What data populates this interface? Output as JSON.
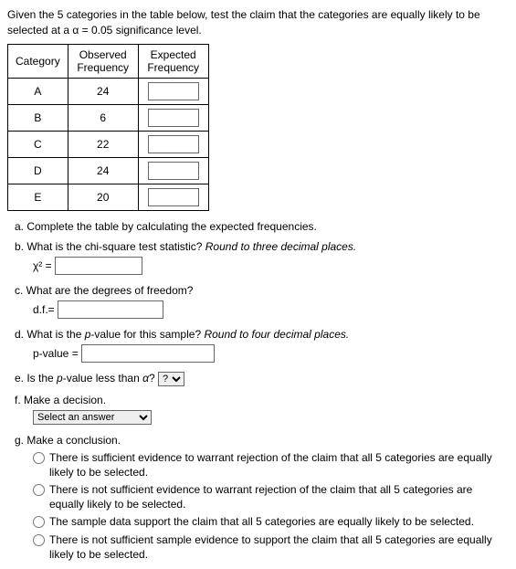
{
  "intro_a": "Given the 5 categories in the table below, test the claim that the categories are equally likely to be selected at a ",
  "alpha": "α = 0.05",
  "intro_b": " significance level.",
  "headers": {
    "cat": "Category",
    "obs": "Observed Frequency",
    "exp": "Expected Frequency"
  },
  "rows": [
    {
      "c": "A",
      "o": "24"
    },
    {
      "c": "B",
      "o": "6"
    },
    {
      "c": "C",
      "o": "22"
    },
    {
      "c": "D",
      "o": "24"
    },
    {
      "c": "E",
      "o": "20"
    }
  ],
  "qa": "a. Complete the table by calculating the expected frequencies.",
  "qb": "b. What is the chi-square test statistic? ",
  "qb_it": "Round to three decimal places.",
  "chi": "χ² = ",
  "qc": "c. What are the degrees of freedom?",
  "df": "d.f.= ",
  "qd": "d. What is the ",
  "qd_p": "p",
  "qd2": "-value for this sample? ",
  "qd_it": "Round to four decimal places.",
  "pv": "p-value = ",
  "qe_a": "e. Is the ",
  "qe_p": "p",
  "qe_b": "-value less than ",
  "qe_al": "α",
  "qe_c": "? ",
  "sel_e": "?",
  "qf": "f. Make a decision.",
  "sel_f": "Select an answer",
  "qg": "g. Make a conclusion.",
  "opt1": "There is sufficient evidence to warrant rejection of the claim that all 5 categories are equally likely to be selected.",
  "opt2": "There is not sufficient evidence to warrant rejection of the claim that all 5 categories are equally likely to be selected.",
  "opt3": "The sample data support the claim that all 5 categories are equally likely to be selected.",
  "opt4": "There is not sufficient sample evidence to support the claim that all 5 categories are equally likely to be selected."
}
